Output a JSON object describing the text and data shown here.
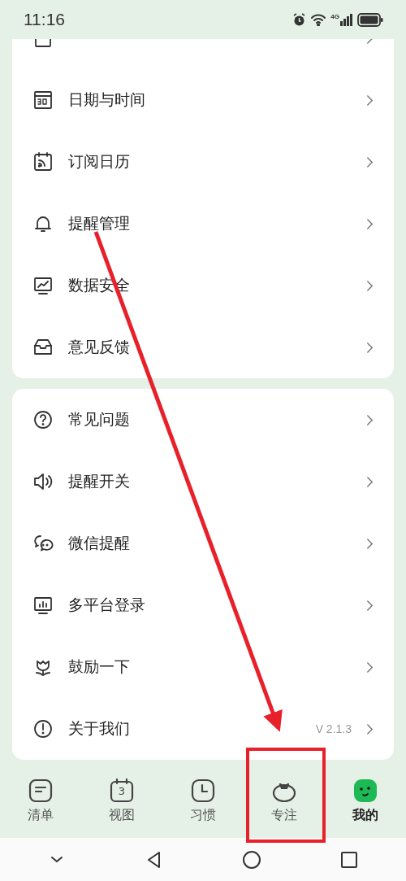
{
  "status_bar": {
    "time": "11:16",
    "network": "4G"
  },
  "groups": [
    {
      "items": [
        {
          "label": "日期与时间"
        },
        {
          "label": "订阅日历"
        },
        {
          "label": "提醒管理"
        },
        {
          "label": "数据安全"
        },
        {
          "label": "意见反馈"
        }
      ]
    },
    {
      "items": [
        {
          "label": "常见问题"
        },
        {
          "label": "提醒开关"
        },
        {
          "label": "微信提醒"
        },
        {
          "label": "多平台登录"
        },
        {
          "label": "鼓励一下"
        },
        {
          "label": "关于我们",
          "value": "V 2.1.3"
        }
      ]
    }
  ],
  "tabs": [
    {
      "label": "清单",
      "selected": false
    },
    {
      "label": "视图",
      "selected": false,
      "icon_text": "3"
    },
    {
      "label": "习惯",
      "selected": false
    },
    {
      "label": "专注",
      "selected": false
    },
    {
      "label": "我的",
      "selected": true
    }
  ]
}
